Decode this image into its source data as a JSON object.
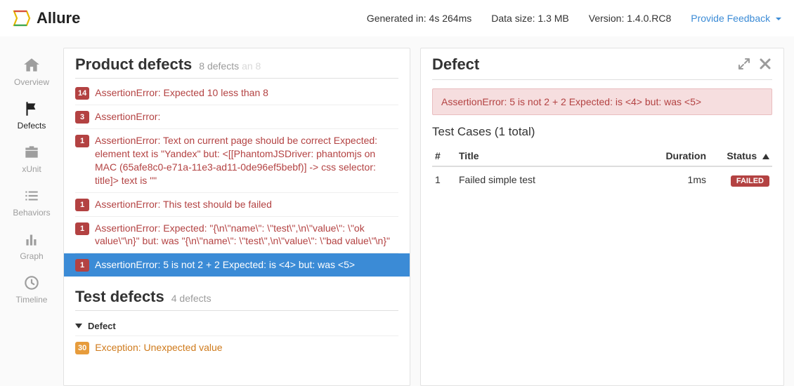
{
  "header": {
    "app_name": "Allure",
    "generated_label": "Generated in: 4s 264ms",
    "datasize_label": "Data size: 1.3 MB",
    "version_label": "Version: 1.4.0.RC8",
    "feedback_label": "Provide Feedback"
  },
  "sidebar": {
    "items": [
      {
        "label": "Overview",
        "icon": "home"
      },
      {
        "label": "Defects",
        "icon": "flag",
        "active": true
      },
      {
        "label": "xUnit",
        "icon": "briefcase"
      },
      {
        "label": "Behaviors",
        "icon": "list"
      },
      {
        "label": "Graph",
        "icon": "bars"
      },
      {
        "label": "Timeline",
        "icon": "clock"
      }
    ]
  },
  "product_defects": {
    "title": "Product defects",
    "count_label": "8 defects",
    "faded_suffix": "an 8",
    "items": [
      {
        "count": "14",
        "msg": "AssertionError: Expected 10 less than 8"
      },
      {
        "count": "3",
        "msg": "AssertionError:"
      },
      {
        "count": "1",
        "msg": "AssertionError: Text on current page should be correct Expected: element text is \"Yandex\" but: <[[PhantomJSDriver: phantomjs on MAC (65afe8c0-e71a-11e3-ad11-0de96ef5bebf)] -> css selector: title]> text is \"\""
      },
      {
        "count": "1",
        "msg": "AssertionError: This test should be failed"
      },
      {
        "count": "1",
        "msg": "AssertionError: Expected: \"{\\n\\\"name\\\": \\\"test\\\",\\n\\\"value\\\": \\\"ok value\\\"\\n}\" but: was \"{\\n\\\"name\\\": \\\"test\\\",\\n\\\"value\\\": \\\"bad value\\\"\\n}\""
      },
      {
        "count": "1",
        "msg": "AssertionError: 5 is not 2 + 2 Expected: is <4> but: was <5>",
        "selected": true
      }
    ]
  },
  "test_defects": {
    "title": "Test defects",
    "count_label": "4 defects",
    "collapse_label": "Defect",
    "items": [
      {
        "count": "30",
        "msg": "Exception: Unexpected value",
        "badge_color": "orange",
        "msg_class": "orange-link"
      }
    ]
  },
  "detail": {
    "title": "Defect",
    "error_message": "AssertionError: 5 is not 2 + 2 Expected: is <4> but: was <5>",
    "cases_title": "Test Cases (1 total)",
    "columns": {
      "num": "#",
      "title": "Title",
      "duration": "Duration",
      "status": "Status"
    },
    "rows": [
      {
        "num": "1",
        "title": "Failed simple test",
        "duration": "1ms",
        "status": "FAILED"
      }
    ]
  }
}
